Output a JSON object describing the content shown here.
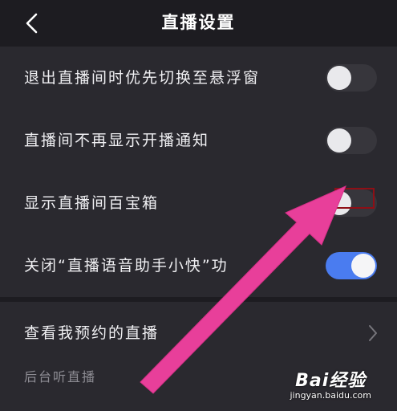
{
  "header": {
    "title": "直播设置"
  },
  "settings": [
    {
      "label": "退出直播间时优先切换至悬浮窗",
      "on": false
    },
    {
      "label": "直播间不再显示开播通知",
      "on": false
    },
    {
      "label": "显示直播间百宝箱",
      "on": false
    },
    {
      "label": "关闭“直播语音助手小快”功",
      "on": true
    }
  ],
  "links": {
    "reservations": "查看我预约的直播"
  },
  "section": {
    "background_listen": "后台听直播"
  },
  "watermark": {
    "logo_text": "Bai经验",
    "url": "jingyan.baidu.com"
  },
  "colors": {
    "accent": "#4a7cf0",
    "annotation_arrow": "#e83f9a",
    "highlight_box": "#8e0f16"
  }
}
